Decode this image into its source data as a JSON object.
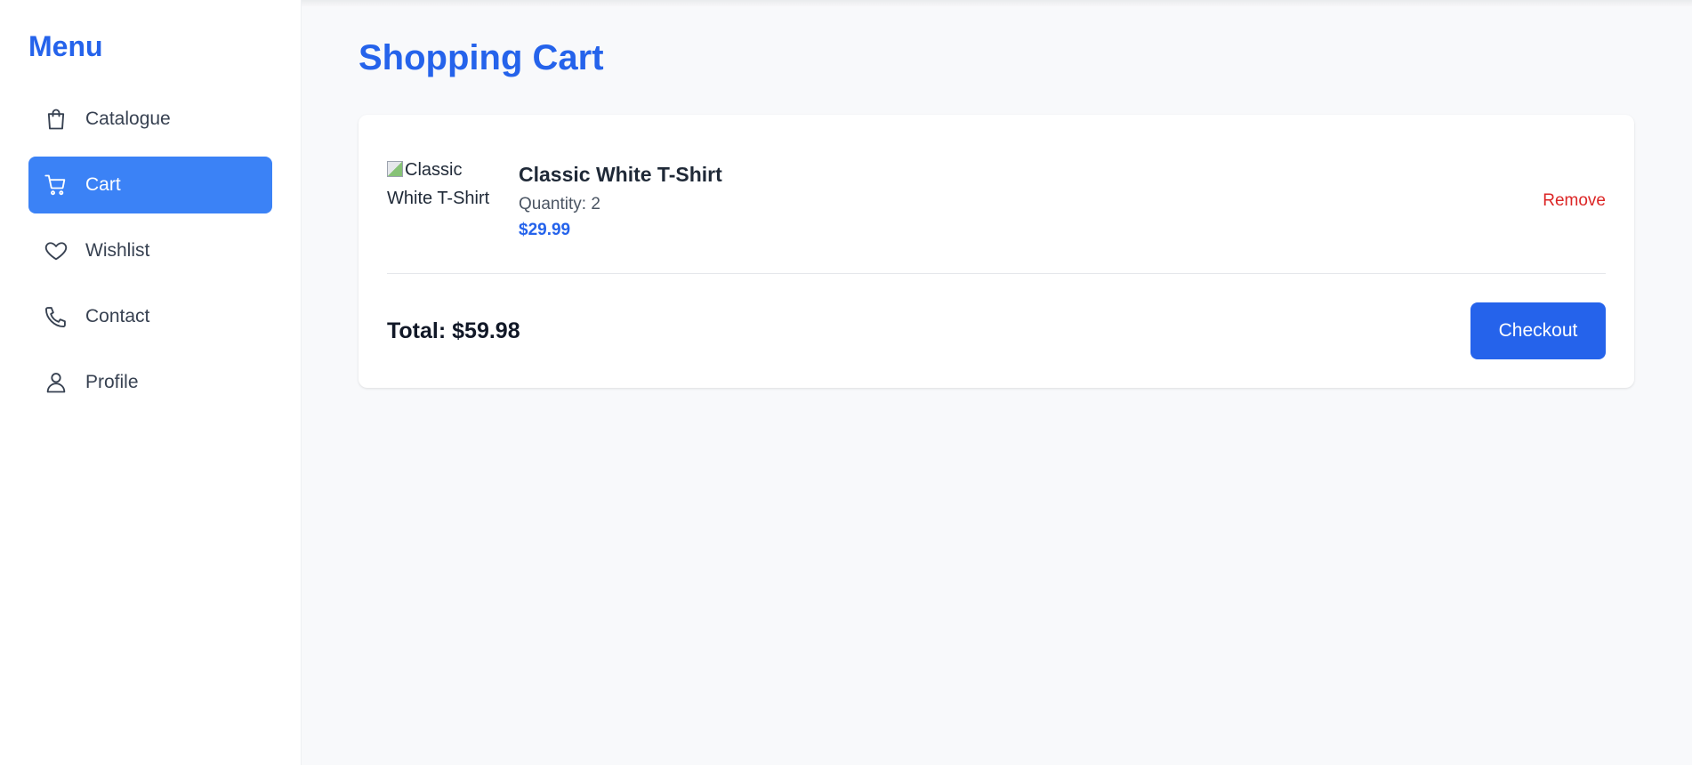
{
  "sidebar": {
    "title": "Menu",
    "items": [
      {
        "label": "Catalogue",
        "icon": "shopping-bag-icon",
        "active": false
      },
      {
        "label": "Cart",
        "icon": "cart-icon",
        "active": true
      },
      {
        "label": "Wishlist",
        "icon": "heart-icon",
        "active": false
      },
      {
        "label": "Contact",
        "icon": "phone-icon",
        "active": false
      },
      {
        "label": "Profile",
        "icon": "user-icon",
        "active": false
      }
    ]
  },
  "main": {
    "title": "Shopping Cart",
    "cart_items": [
      {
        "image_alt": "Classic White T-Shirt",
        "name": "Classic White T-Shirt",
        "quantity": "Quantity: 2",
        "price": "$29.99",
        "remove_label": "Remove"
      }
    ],
    "total": "Total: $59.98",
    "checkout_label": "Checkout"
  },
  "colors": {
    "accent": "#2563eb",
    "active_nav": "#3b82f6",
    "remove": "#dc2626",
    "background": "#f8f9fb"
  }
}
